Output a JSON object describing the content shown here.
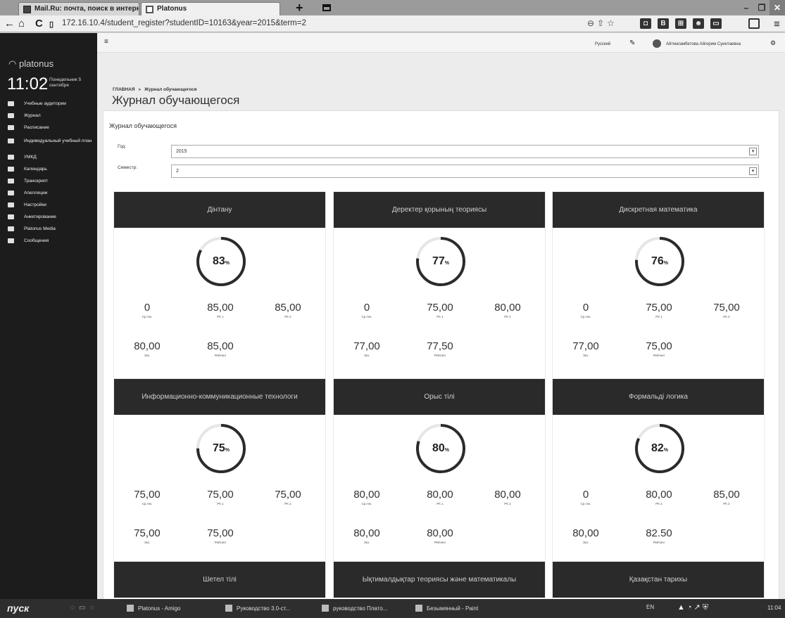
{
  "browser": {
    "tabs": [
      {
        "label": "Mail.Ru: почта, поиск в интерн"
      },
      {
        "label": "Platonus"
      }
    ],
    "url": "172.16.10.4/student_register?studentID=10163&year=2015&term=2",
    "window_buttons": [
      "–",
      "❐",
      "✕"
    ],
    "new_tab_label": "+"
  },
  "sidebar": {
    "logo": "platonus",
    "clock": "11:02",
    "date": "Понедельник 5 сентября",
    "items": [
      {
        "label": "Учебные аудитории",
        "icon": "users-icon"
      },
      {
        "label": "Журнал",
        "icon": "journal-icon"
      },
      {
        "label": "Расписание",
        "icon": "schedule-icon"
      },
      {
        "label": "Индивидуальный учебный план",
        "icon": "plan-icon"
      },
      {
        "label": "УМКД",
        "icon": "book-icon"
      },
      {
        "label": "Календарь",
        "icon": "calendar-icon"
      },
      {
        "label": "Транскрипт",
        "icon": "transcript-icon"
      },
      {
        "label": "Апелляции",
        "icon": "appeal-icon"
      },
      {
        "label": "Настройки",
        "icon": "settings-icon"
      },
      {
        "label": "Анкетирование",
        "icon": "survey-icon"
      },
      {
        "label": "Platonus Media",
        "icon": "media-icon"
      },
      {
        "label": "Сообщения",
        "icon": "message-icon"
      }
    ]
  },
  "topbar": {
    "language": "Русский",
    "user_name": "Айтмагамбетова Айгерим Суинтаевна"
  },
  "breadcrumb": {
    "home": "ГЛАВНАЯ",
    "separator": "»",
    "current": "Журнал обучающегося"
  },
  "page_title": "Журнал обучающегося",
  "panel": {
    "heading": "Журнал обучающегося",
    "year_label": "Год:",
    "year_value": "2015",
    "term_label": "Семестр:",
    "term_value": "2",
    "dropdown_arrow": "▾"
  },
  "labels": {
    "current": "Ср.тек.",
    "rk1": "РК 1",
    "rk2": "РК 2",
    "exam": "Экз.",
    "rating": "Рейтинг",
    "percent": "%"
  },
  "subjects": [
    {
      "name": "Дінтану",
      "percent": "83",
      "current": "0",
      "rk1": "85,00",
      "rk2": "85,00",
      "exam": "80,00",
      "rating": "85,00"
    },
    {
      "name": "Деректер қорының теориясы",
      "percent": "77",
      "current": "0",
      "rk1": "75,00",
      "rk2": "80,00",
      "exam": "77,00",
      "rating": "77,50"
    },
    {
      "name": "Дискретная математика",
      "percent": "76",
      "current": "0",
      "rk1": "75,00",
      "rk2": "75,00",
      "exam": "77,00",
      "rating": "75,00"
    },
    {
      "name": "Информационно-коммуникационные технологи",
      "percent": "75",
      "current": "75,00",
      "rk1": "75,00",
      "rk2": "75,00",
      "exam": "75,00",
      "rating": "75,00"
    },
    {
      "name": "Орыс тілі",
      "percent": "80",
      "current": "80,00",
      "rk1": "80,00",
      "rk2": "80,00",
      "exam": "80,00",
      "rating": "80,00"
    },
    {
      "name": "Формальді логика",
      "percent": "82",
      "current": "0",
      "rk1": "80,00",
      "rk2": "85,00",
      "exam": "80,00",
      "rating": "82.50"
    },
    {
      "name": "Шетел тілі"
    },
    {
      "name": "Ықтималдықтар теориясы және математикалы"
    },
    {
      "name": "Қазақстан тарихы"
    }
  ],
  "taskbar": {
    "start": "пуск",
    "tasks": [
      {
        "label": "Platonus - Amigo"
      },
      {
        "label": "Руководство 3.0-ст..."
      },
      {
        "label": "руководство Плато..."
      },
      {
        "label": "Безымянный - Paint"
      }
    ],
    "lang": "EN",
    "time": "11:04"
  },
  "colors": {
    "sidebar_bg": "#1c1c1c",
    "card_header_bg": "#2a2a2a",
    "ring_color": "#2b2b2b",
    "ring_track": "#e6e6e6"
  }
}
